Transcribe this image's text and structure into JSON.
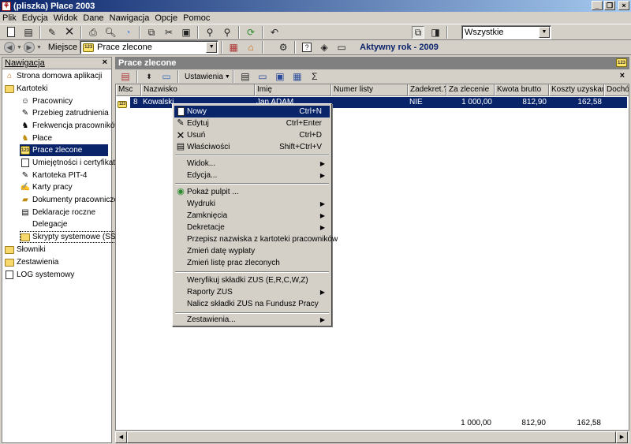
{
  "window": {
    "title": "(pliszka)  Płace 2003"
  },
  "menu": [
    "Plik",
    "Edycja",
    "Widok",
    "Dane",
    "Nawigacja",
    "Opcje",
    "Pomoc"
  ],
  "toolbar": {
    "filter_value": "Wszystkie"
  },
  "location": {
    "label": "Miejsce",
    "value": "Prace zlecone",
    "active_year": "Aktywny rok - 2009"
  },
  "nav": {
    "header": "Nawigacja",
    "items": [
      {
        "label": "Strona domowa aplikacji",
        "icon": "home-icon"
      },
      {
        "label": "Kartoteki",
        "icon": "folder-open-icon"
      },
      {
        "label": "Pracownicy",
        "icon": "employees-icon"
      },
      {
        "label": "Przebieg zatrudnienia",
        "icon": "employment-history-icon"
      },
      {
        "label": "Frekwencja pracowników",
        "icon": "attendance-icon"
      },
      {
        "label": "Płace",
        "icon": "payroll-icon"
      },
      {
        "label": "Prace zlecone",
        "icon": "badge-123-icon"
      },
      {
        "label": "Umiejętności i certyfikaty",
        "icon": "certificate-icon"
      },
      {
        "label": "Kartoteka PIT-4",
        "icon": "pit-icon"
      },
      {
        "label": "Karty pracy",
        "icon": "work-card-icon"
      },
      {
        "label": "Dokumenty pracownicze",
        "icon": "documents-icon"
      },
      {
        "label": "Deklaracje roczne",
        "icon": "declaration-icon"
      },
      {
        "label": "Delegacje",
        "icon": "blank-icon"
      },
      {
        "label": "Skrypty systemowe (SSH)",
        "icon": "folder-icon"
      },
      {
        "label": "Słowniki",
        "icon": "folder-icon"
      },
      {
        "label": "Zestawienia",
        "icon": "folder-icon"
      },
      {
        "label": "LOG systemowy",
        "icon": "log-icon"
      }
    ]
  },
  "main": {
    "title": "Prace zlecone",
    "settings_label": "Ustawienia",
    "sigma": "Σ",
    "columns": [
      "Msc",
      "Nazwisko",
      "Imię",
      "Numer listy",
      "Zadekret.?",
      "Za zlecenie",
      "Kwota brutto",
      "Koszty uzyskania",
      "Dochód"
    ],
    "row": {
      "msc": "8",
      "nazwisko": "Kowalski",
      "imie": "Jan ADAM",
      "numer_listy": "",
      "zadekret": "NIE",
      "za_zlecenie": "1 000,00",
      "kwota_brutto": "812,90",
      "koszty": "162,58",
      "dochod": ""
    },
    "totals": {
      "za_zlecenie": "1 000,00",
      "kwota_brutto": "812,90",
      "koszty": "162,58"
    }
  },
  "context_menu": {
    "new_label": "Nowy",
    "new_shortcut": "Ctrl+N",
    "edit_label": "Edytuj",
    "edit_shortcut": "Ctrl+Enter",
    "delete_label": "Usuń",
    "delete_shortcut": "Ctrl+D",
    "props_label": "Właściwości",
    "props_shortcut": "Shift+Ctrl+V",
    "view_label": "Widok...",
    "edition_label": "Edycja...",
    "desktop_label": "Pokaż pulpit ...",
    "prints_label": "Wydruki",
    "closures_label": "Zamknięcia",
    "decrees_label": "Dekretacje",
    "rewrite_label": "Przepisz nazwiska z kartoteki pracowników",
    "change_date_label": "Zmień datę wypłaty",
    "change_list_label": "Zmień listę prac zleconych",
    "verify_zus_label": "Weryfikuj składki ZUS (E,R,C,W,Z)",
    "zus_reports_label": "Raporty ZUS",
    "zus_fund_label": "Nalicz składki ZUS na Fundusz Pracy",
    "summaries_label": "Zestawienia..."
  },
  "colors": {
    "titlebar": "#0a246a",
    "selection": "#0a246a",
    "active_year": "#0a246a"
  }
}
